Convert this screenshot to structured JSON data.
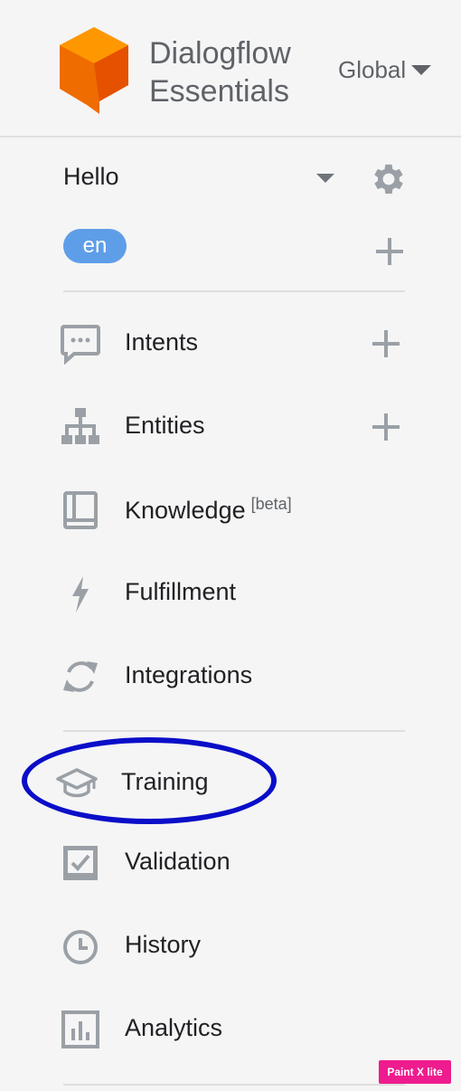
{
  "header": {
    "brand_line1": "Dialogflow",
    "brand_line2": "Essentials",
    "region": "Global"
  },
  "agent": {
    "name": "Hello",
    "language": "en"
  },
  "nav": {
    "intents": "Intents",
    "entities": "Entities",
    "knowledge": "Knowledge",
    "knowledge_badge": "[beta]",
    "fulfillment": "Fulfillment",
    "integrations": "Integrations",
    "training": "Training",
    "validation": "Validation",
    "history": "History",
    "analytics": "Analytics"
  },
  "icons": {
    "intents": "chat-bubble-icon",
    "entities": "hierarchy-icon",
    "knowledge": "book-icon",
    "fulfillment": "lightning-icon",
    "integrations": "sync-icon",
    "training": "graduation-cap-icon",
    "validation": "checkbox-icon",
    "history": "clock-icon",
    "analytics": "bar-chart-icon"
  },
  "colors": {
    "accent": "#5e9ee8",
    "icon_gray": "#9aa0a6",
    "logo_orange": "#ef6c00",
    "highlight": "#0a0ec8"
  },
  "watermark": "Paint X lite"
}
